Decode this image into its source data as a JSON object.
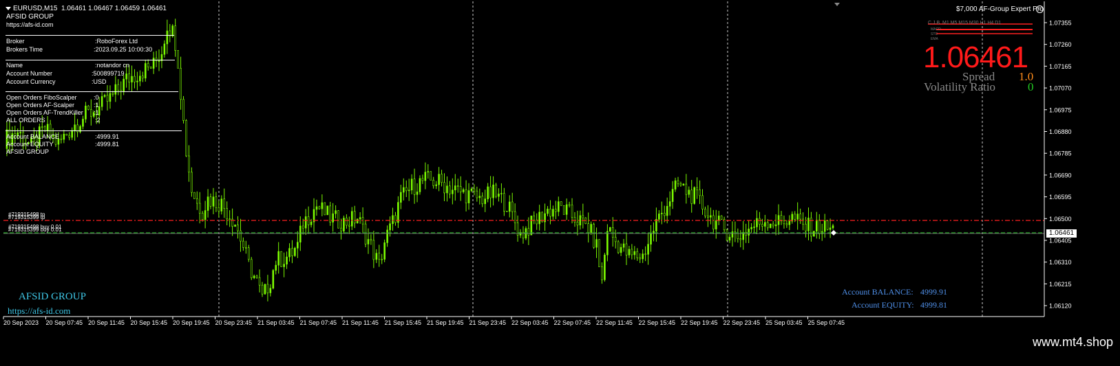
{
  "header": {
    "symbol": "EURUSD,M15",
    "ohlc": "1.06461 1.06467 1.06459 1.06461",
    "expert": "$7,000 AF-Group Expert Pro"
  },
  "info_panel": {
    "brand": "AFSID GROUP",
    "url": "https://afs-id.com",
    "rows": [
      {
        "label": "Broker",
        "value": ":RoboForex Ltd"
      },
      {
        "label": "Brokers Time",
        "value": ":2023.09.25 10:00:30"
      },
      {
        "label": "Name",
        "value": ":notandor cn"
      },
      {
        "label": "Account Number",
        "value": ":500899719"
      },
      {
        "label": "Account Currency",
        "value": ":USD"
      },
      {
        "label": "Open Orders FiboScalper",
        "value": ":0"
      },
      {
        "label": "Open Orders AF-Scalper",
        "value": ":1"
      },
      {
        "label": "Open Orders AF-TrendKiller",
        "value": ":1"
      },
      {
        "label": "ALL ORDERS",
        "value": ":2"
      },
      {
        "label": "Account BALANCE",
        "value": ":4999.91"
      },
      {
        "label": "Account EQUITY",
        "value": ":4999.81"
      },
      {
        "label": "AFSID GROUP",
        "value": ""
      }
    ]
  },
  "orders": {
    "tp_label": "#719315498 tp",
    "tp_label2": "#719315399 tp",
    "buy_label": "#719315498 buy 0.01",
    "buy_label2": "#719315399 buy 0.01"
  },
  "dashboard": {
    "timeframes": "C.J.B.   M1   M5  M15 M30   H1    H4   D1",
    "indicators": [
      "MACD",
      "STO",
      "EMA"
    ],
    "price": "1.06461",
    "spread_label": "Spread",
    "spread_value": "1.0",
    "volatility_label": "Volatility Ratio",
    "volatility_value": "0"
  },
  "bottom_left": {
    "brand": "AFSID GROUP",
    "url": "https://afs-id.com"
  },
  "bottom_right": {
    "balance_label": "Account BALANCE:",
    "balance_value": "4999.91",
    "equity_label": "Account EQUITY:",
    "equity_value": "4999.81"
  },
  "price_axis": {
    "current": "1.06461",
    "ticks": [
      "1.07355",
      "1.07260",
      "1.07165",
      "1.07070",
      "1.06975",
      "1.06880",
      "1.06785",
      "1.06690",
      "1.06595",
      "1.06500",
      "1.06405",
      "1.06310",
      "1.06215",
      "1.06120"
    ]
  },
  "time_axis": [
    "20 Sep 2023",
    "20 Sep 07:45",
    "20 Sep 11:45",
    "20 Sep 15:45",
    "20 Sep 19:45",
    "20 Sep 23:45",
    "21 Sep 03:45",
    "21 Sep 07:45",
    "21 Sep 11:45",
    "21 Sep 15:45",
    "21 Sep 19:45",
    "21 Sep 23:45",
    "22 Sep 03:45",
    "22 Sep 07:45",
    "22 Sep 11:45",
    "22 Sep 15:45",
    "22 Sep 19:45",
    "22 Sep 23:45",
    "25 Sep 03:45",
    "25 Sep 07:45"
  ],
  "footer": "www.mt4.shop",
  "colors": {
    "bull": "#7cfc00",
    "bear": "#ffffff",
    "tp_line": "#ff2020",
    "entry_line": "#22aa22",
    "grid": "#ffffff"
  },
  "chart_data": {
    "type": "candlestick",
    "ylim": [
      1.0612,
      1.0741
    ],
    "close_path": [
      [
        0,
        1.0685
      ],
      [
        5,
        1.0688
      ],
      [
        10,
        1.0682
      ],
      [
        15,
        1.0689
      ],
      [
        20,
        1.0683
      ],
      [
        25,
        1.069
      ],
      [
        30,
        1.0695
      ],
      [
        35,
        1.0698
      ],
      [
        40,
        1.0703
      ],
      [
        45,
        1.071
      ],
      [
        50,
        1.0713
      ],
      [
        55,
        1.0716
      ],
      [
        58,
        1.0722
      ],
      [
        60,
        1.0733
      ],
      [
        62,
        1.073
      ],
      [
        63,
        1.0726
      ],
      [
        64,
        1.0718
      ],
      [
        66,
        1.0692
      ],
      [
        67,
        1.068
      ],
      [
        69,
        1.0664
      ],
      [
        71,
        1.0658
      ],
      [
        73,
        1.0655
      ],
      [
        75,
        1.066
      ],
      [
        80,
        1.0658
      ],
      [
        85,
        1.065
      ],
      [
        88,
        1.064
      ],
      [
        90,
        1.0632
      ],
      [
        93,
        1.0625
      ],
      [
        95,
        1.0618
      ],
      [
        98,
        1.0626
      ],
      [
        100,
        1.0634
      ],
      [
        105,
        1.0636
      ],
      [
        108,
        1.064
      ],
      [
        110,
        1.065
      ],
      [
        113,
        1.0654
      ],
      [
        115,
        1.0657
      ],
      [
        120,
        1.0652
      ],
      [
        125,
        1.065
      ],
      [
        130,
        1.0652
      ],
      [
        135,
        1.064
      ],
      [
        138,
        1.0632
      ],
      [
        140,
        1.0642
      ],
      [
        143,
        1.065
      ],
      [
        146,
        1.066
      ],
      [
        150,
        1.0665
      ],
      [
        155,
        1.0668
      ],
      [
        160,
        1.0667
      ],
      [
        165,
        1.0664
      ],
      [
        170,
        1.0662
      ],
      [
        175,
        1.066
      ],
      [
        180,
        1.0662
      ],
      [
        185,
        1.0658
      ],
      [
        190,
        1.0645
      ],
      [
        195,
        1.065
      ],
      [
        200,
        1.0655
      ],
      [
        205,
        1.0656
      ],
      [
        210,
        1.0652
      ],
      [
        215,
        1.0648
      ],
      [
        218,
        1.064
      ],
      [
        220,
        1.0625
      ],
      [
        222,
        1.0648
      ],
      [
        225,
        1.0642
      ],
      [
        230,
        1.0636
      ],
      [
        235,
        1.0636
      ],
      [
        240,
        1.065
      ],
      [
        245,
        1.066
      ],
      [
        248,
        1.0666
      ],
      [
        250,
        1.0664
      ],
      [
        255,
        1.066
      ],
      [
        260,
        1.0652
      ],
      [
        265,
        1.0647
      ],
      [
        270,
        1.0644
      ],
      [
        275,
        1.0648
      ],
      [
        280,
        1.0651
      ],
      [
        285,
        1.065
      ],
      [
        290,
        1.0652
      ],
      [
        295,
        1.0648
      ],
      [
        300,
        1.0648
      ],
      [
        305,
        1.0647
      ]
    ]
  }
}
